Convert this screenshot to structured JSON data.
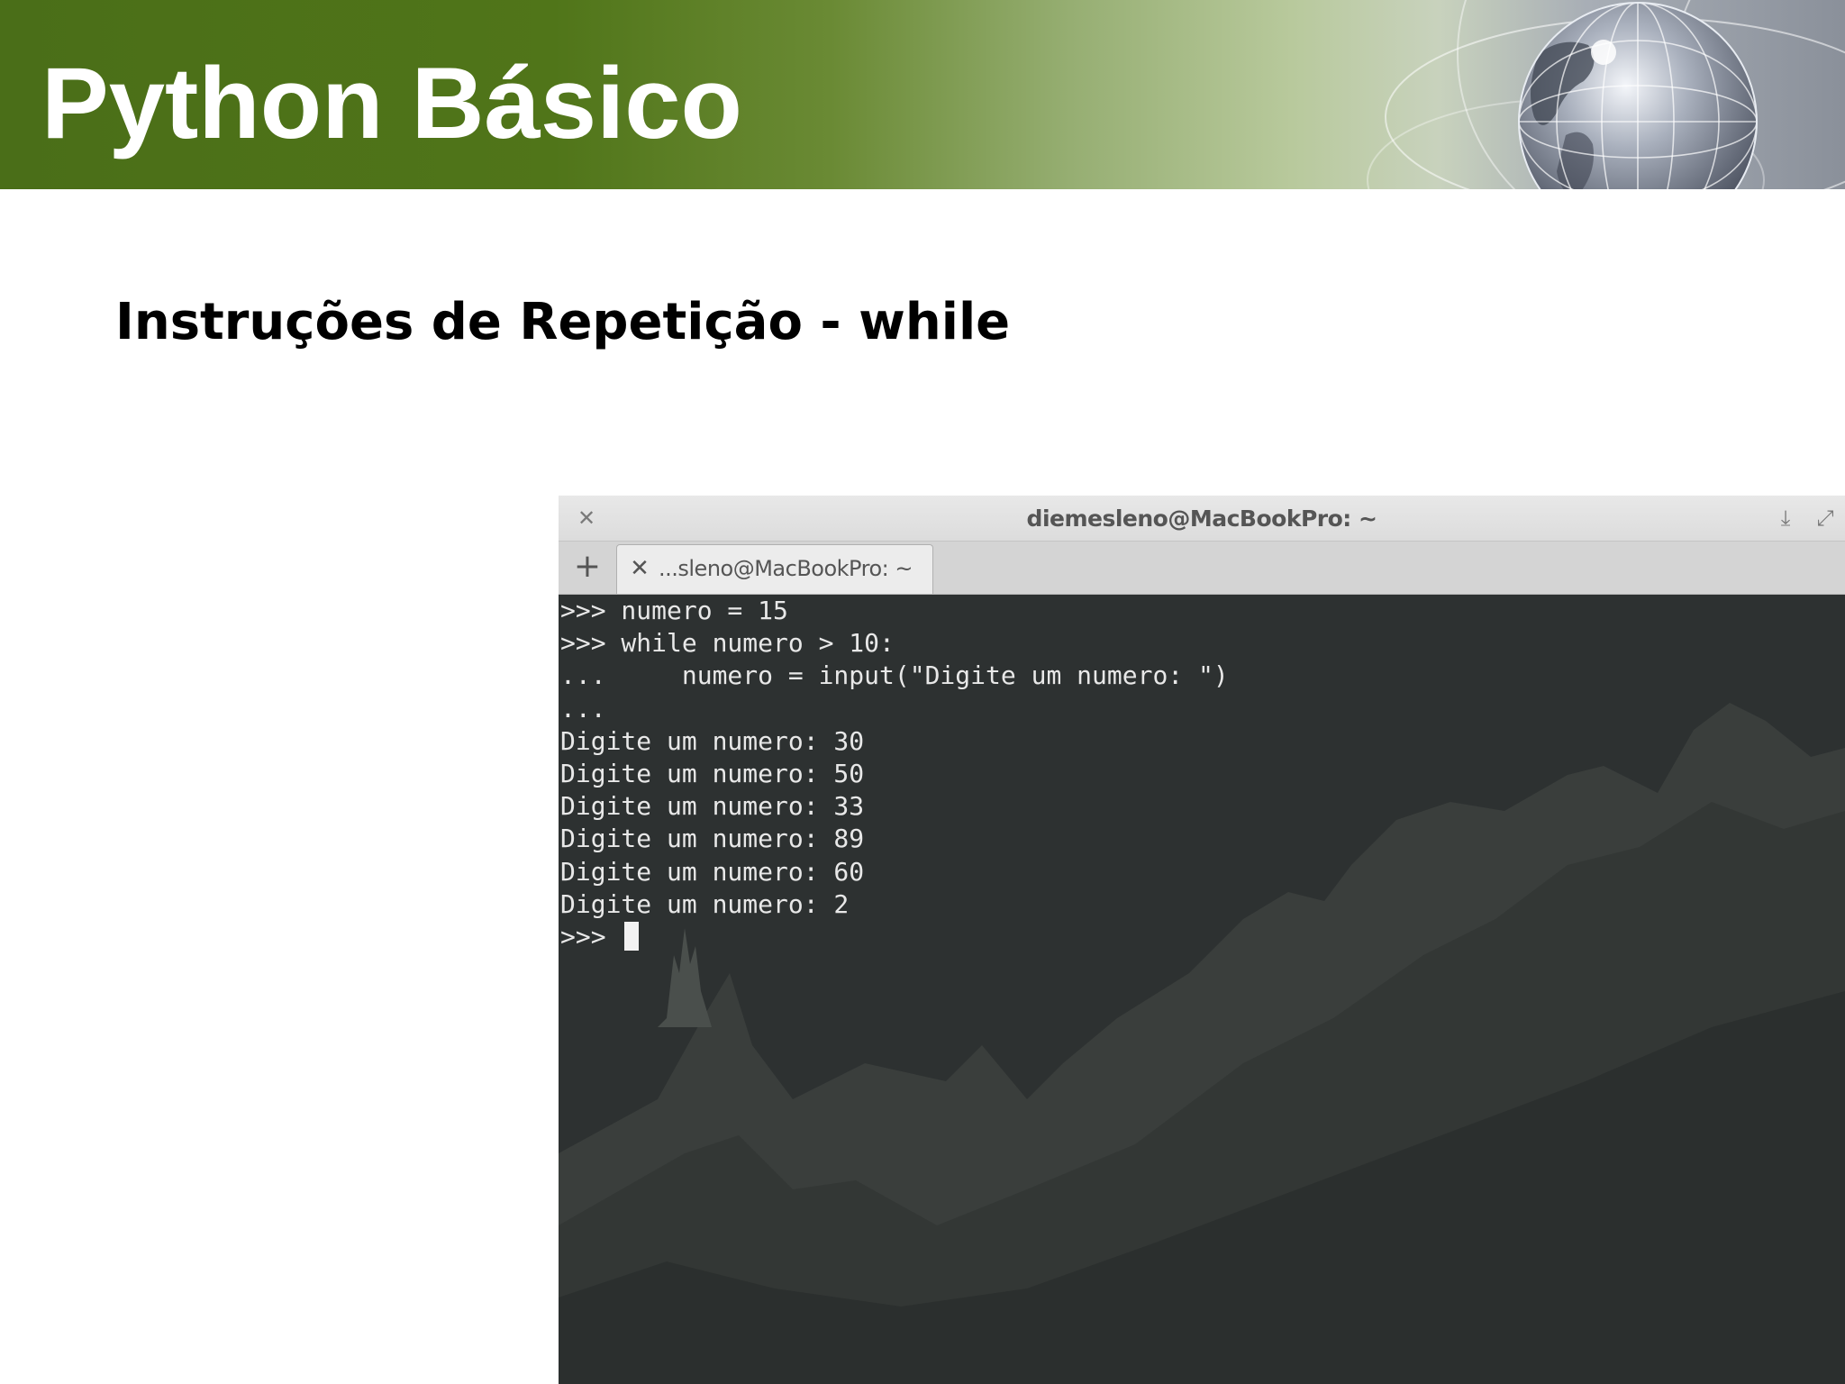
{
  "slide": {
    "title": "Python Básico",
    "subtitle": "Instruções de Repetição - while"
  },
  "terminal": {
    "window_title": "diemesleno@MacBookPro: ~",
    "tab_label": "...sleno@MacBookPro: ~",
    "lines": [
      ">>> numero = 15",
      ">>> while numero > 10:",
      "...     numero = input(\"Digite um numero: \")",
      "...",
      "Digite um numero: 30",
      "Digite um numero: 50",
      "Digite um numero: 33",
      "Digite um numero: 89",
      "Digite um numero: 60",
      "Digite um numero: 2"
    ],
    "prompt": ">>> ",
    "icons": {
      "close": "close-icon",
      "download": "download-icon",
      "maximize": "maximize-icon",
      "new_tab": "plus-icon",
      "tab_close": "close-icon"
    }
  },
  "colors": {
    "banner_green": "#4a6e18",
    "terminal_bg": "#2d3131",
    "terminal_text": "#e8e8e8"
  }
}
